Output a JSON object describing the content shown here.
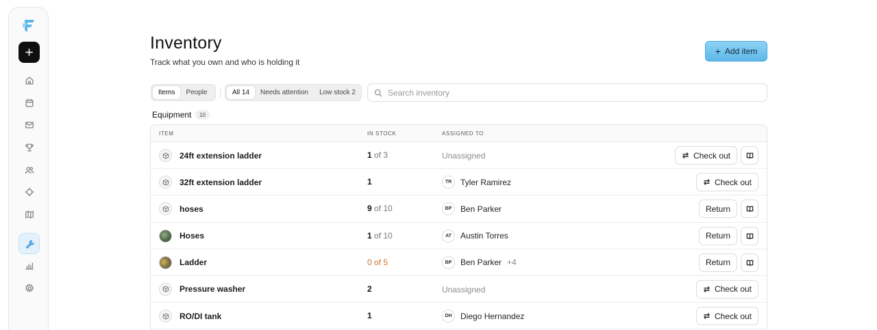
{
  "sidebar": {
    "logo_icon": "ff-logo-icon",
    "new_icon": "plus-icon",
    "nav": [
      {
        "icon": "home-icon",
        "active": false
      },
      {
        "icon": "calendar-icon",
        "active": false
      },
      {
        "icon": "mail-icon",
        "active": false
      },
      {
        "icon": "trophy-icon",
        "active": false
      },
      {
        "icon": "users-icon",
        "active": false
      },
      {
        "icon": "target-icon",
        "active": false
      },
      {
        "icon": "map-icon",
        "active": false
      },
      {
        "icon": "wrench-icon",
        "active": true
      },
      {
        "icon": "bar-chart-icon",
        "active": false
      },
      {
        "icon": "settings-icon",
        "active": false
      }
    ],
    "accent_color": "#3b9ad9"
  },
  "header": {
    "title": "Inventory",
    "subtitle": "Track what you own and who is holding it",
    "add_button": "Add item"
  },
  "toolbar": {
    "view_tabs": [
      {
        "label": "Items",
        "selected": true
      },
      {
        "label": "People",
        "selected": false
      }
    ],
    "filters": [
      {
        "label": "All 14",
        "selected": true
      },
      {
        "label": "Needs attention",
        "selected": false
      },
      {
        "label": "Low stock 2",
        "selected": false
      }
    ],
    "search_placeholder": "Search inventory"
  },
  "section": {
    "title": "Equipment",
    "count": "10"
  },
  "table": {
    "columns": [
      "ITEM",
      "IN STOCK",
      "ASSIGNED TO"
    ],
    "rows": [
      {
        "name": "24ft extension ladder",
        "icon": "box-icon",
        "stock_num": "1",
        "stock_total": " of 3",
        "assigned": "Unassigned",
        "initials": "",
        "extra": "",
        "action": "Check out",
        "has_book": true
      },
      {
        "name": "32ft extension ladder",
        "icon": "box-icon",
        "stock_num": "1",
        "stock_total": "",
        "assigned": "Tyler Ramirez",
        "initials": "TR",
        "extra": "",
        "action": "Check out",
        "has_book": false
      },
      {
        "name": "hoses",
        "icon": "box-icon",
        "stock_num": "9",
        "stock_total": " of 10",
        "assigned": "Ben Parker",
        "initials": "BP",
        "extra": "",
        "action": "Return",
        "has_book": true
      },
      {
        "name": "Hoses",
        "icon": "hoses-photo",
        "stock_num": "1",
        "stock_total": " of 10",
        "assigned": "Austin Torres",
        "initials": "AT",
        "extra": "",
        "action": "Return",
        "has_book": true
      },
      {
        "name": "Ladder",
        "icon": "ladder-photo",
        "stock_num": "0",
        "stock_total": " of 5",
        "warn": true,
        "assigned": "Ben Parker",
        "initials": "BP",
        "extra": "+4",
        "action": "Return",
        "has_book": true
      },
      {
        "name": "Pressure washer",
        "icon": "box-icon",
        "stock_num": "2",
        "stock_total": "",
        "assigned": "Unassigned",
        "initials": "",
        "extra": "",
        "action": "Check out",
        "has_book": false
      },
      {
        "name": "RO/DI tank",
        "icon": "box-icon",
        "stock_num": "1",
        "stock_total": "",
        "assigned": "Diego Hernandez",
        "initials": "DH",
        "extra": "",
        "action": "Check out",
        "has_book": false
      }
    ],
    "warn_color": "#d0702a"
  }
}
